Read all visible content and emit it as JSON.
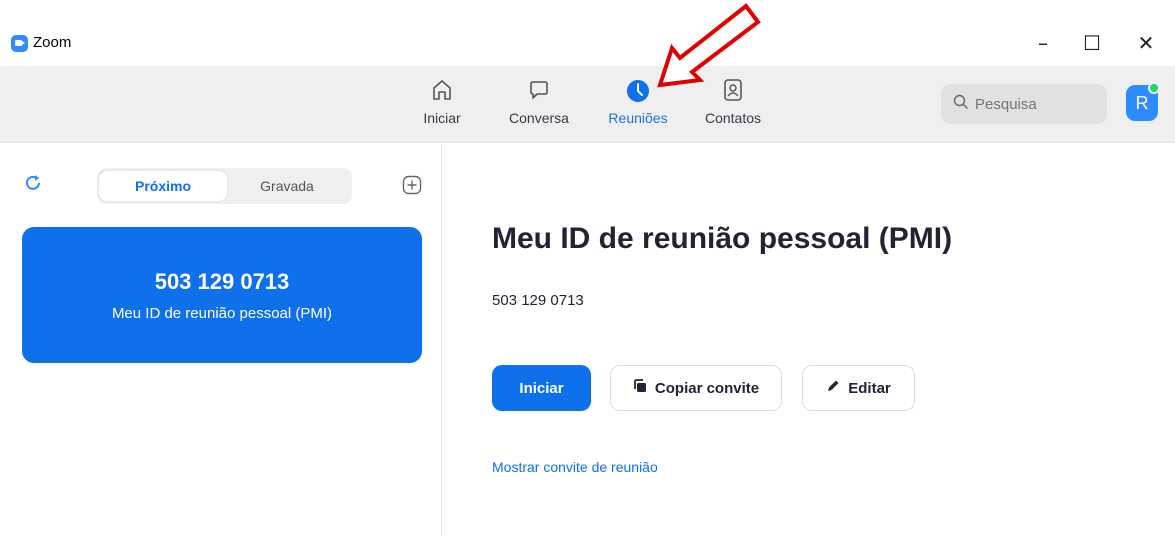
{
  "window": {
    "title": "Zoom",
    "controls": [
      "–",
      "☐",
      "✕"
    ]
  },
  "nav": {
    "items": [
      {
        "label": "Iniciar",
        "icon": "home-icon",
        "active": false
      },
      {
        "label": "Conversa",
        "icon": "chat-icon",
        "active": false
      },
      {
        "label": "Reuniões",
        "icon": "clock-icon",
        "active": true
      },
      {
        "label": "Contatos",
        "icon": "contacts-icon",
        "active": false
      }
    ],
    "search": {
      "placeholder": "Pesquisa"
    },
    "avatar": {
      "initial": "R",
      "status_color": "#2bd164"
    }
  },
  "sidebar": {
    "tabs": [
      {
        "label": "Próximo",
        "active": true
      },
      {
        "label": "Gravada",
        "active": false
      }
    ],
    "meeting_card": {
      "id": "503 129 0713",
      "label": "Meu ID de reunião pessoal (PMI)"
    }
  },
  "main": {
    "title": "Meu ID de reunião pessoal (PMI)",
    "meeting_id": "503 129 0713",
    "buttons": {
      "start": "Iniciar",
      "copy_invite": "Copiar convite",
      "edit": "Editar"
    },
    "show_invite_link": "Mostrar convite de reunião"
  },
  "colors": {
    "accent": "#0e71eb",
    "annotation": "#e00000"
  }
}
